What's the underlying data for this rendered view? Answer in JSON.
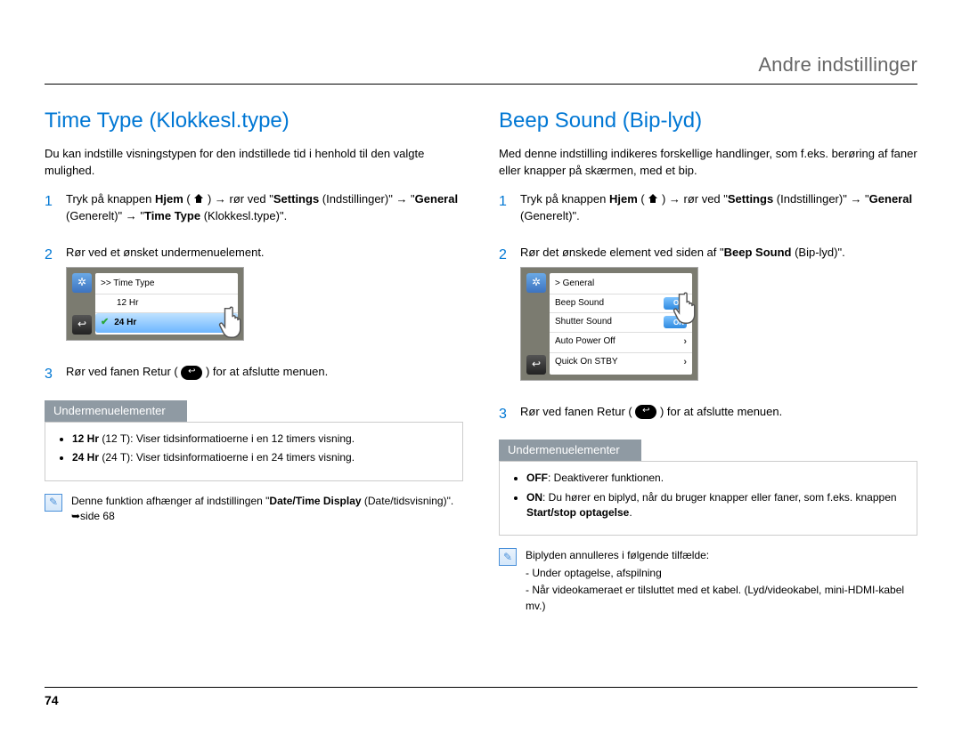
{
  "runningHead": "Andre indstillinger",
  "pageNum": "74",
  "left": {
    "heading": "Time Type (Klokkesl.type)",
    "intro": "Du kan indstille visningstypen for den indstillede tid i henhold til den valgte mulighed.",
    "step1": {
      "n": "1",
      "t_a": "Tryk på knappen ",
      "t_b": "Hjem",
      "t_c": " ( ",
      "t_d": " ) → rør ved \"",
      "t_e": "Settings",
      "t_f": " (Indstillinger)\" → \"",
      "t_g": "General",
      "t_h": " (Generelt)\" → \"",
      "t_i": "Time Type",
      "t_j": " (Klokkesl.type)\"."
    },
    "step2": {
      "n": "2",
      "text": "Rør ved et ønsket undermenuelement."
    },
    "screen": {
      "crumb": ">> Time Type",
      "opt1": "12 Hr",
      "opt2": "24 Hr"
    },
    "step3": {
      "n": "3",
      "a": "Rør ved fanen Retur ( ",
      "b": " ) for at afslutte menuen."
    },
    "subHead": "Undermenuelementer",
    "sub1a": "12 Hr",
    "sub1b": " (12 T): Viser tidsinformatioerne i en 12 timers visning.",
    "sub2a": "24 Hr",
    "sub2b": " (24 T): Viser tidsinformatioerne i en 24 timers visning.",
    "noteA": "Denne funktion afhænger af indstillingen \"",
    "noteB": "Date/Time Display",
    "noteC": " (Date/tidsvisning)\". ➥side 68"
  },
  "right": {
    "heading": "Beep Sound (Bip-lyd)",
    "intro": "Med denne indstilling indikeres forskellige handlinger, som f.eks. berøring af faner eller knapper på skærmen, med et bip.",
    "step1": {
      "n": "1",
      "t_a": "Tryk på knappen ",
      "t_b": "Hjem",
      "t_c": " ( ",
      "t_d": " ) → rør ved \"",
      "t_e": "Settings",
      "t_f": " (Indstillinger)\" → \"",
      "t_g": "General",
      "t_h": " (Generelt)\"."
    },
    "step2": {
      "n": "2",
      "a": "Rør det ønskede element ved siden af \"",
      "b": "Beep Sound",
      "c": " (Bip-lyd)\"."
    },
    "screen": {
      "crumb": "> General",
      "r1": "Beep Sound",
      "r2": "Shutter Sound",
      "r3": "Auto Power Off",
      "r4": "Quick On STBY",
      "on": "ON"
    },
    "step3": {
      "n": "3",
      "a": "Rør ved fanen Retur ( ",
      "b": " ) for at afslutte menuen."
    },
    "subHead": "Undermenuelementer",
    "sub1a": "OFF",
    "sub1b": ": Deaktiverer funktionen.",
    "sub2a": "ON",
    "sub2b": ": Du hører en biplyd, når du bruger knapper eller faner, som f.eks. knappen ",
    "sub2c": "Start/stop optagelse",
    "sub2d": ".",
    "note1": "Biplyden annulleres i følgende tilfælde:",
    "note2": "- Under optagelse, afspilning",
    "note3": "- Når videokameraet er tilsluttet med et kabel. (Lyd/videokabel, mini-HDMI-kabel mv.)"
  }
}
